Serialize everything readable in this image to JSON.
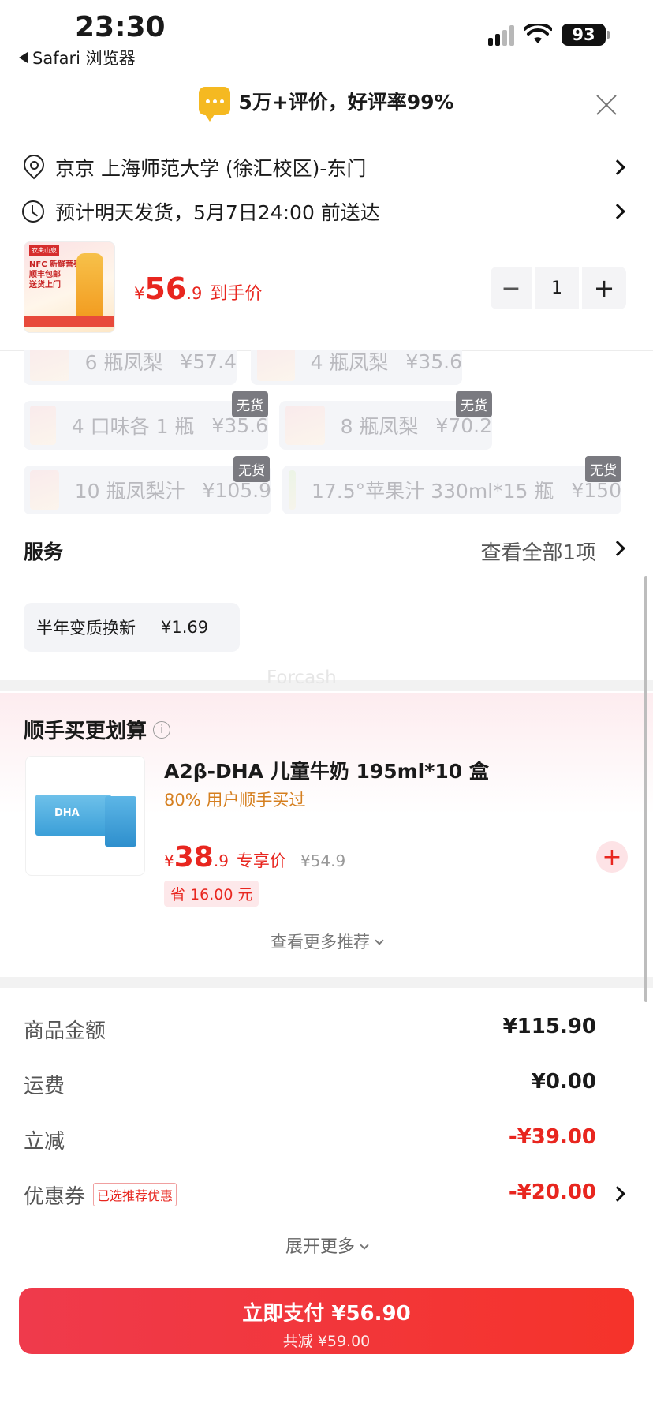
{
  "status_bar": {
    "time": "23:30",
    "back_app": "Safari 浏览器",
    "battery": "93"
  },
  "banner": {
    "text": "5万+评价，好评率99%"
  },
  "address": {
    "text": "京京  上海师范大学 (徐汇校区)-东门"
  },
  "delivery": {
    "text": "预计明天发货，5月7日24:00 前送达"
  },
  "product": {
    "currency": "¥",
    "price_int": "56",
    "price_dec": ".9",
    "price_suffix": "到手价",
    "quantity": "1",
    "minus": "−",
    "plus": "+",
    "thumb_text": "NFC 新鲜营养\n顺丰包邮\n送货上门"
  },
  "variants": [
    {
      "label": "6 瓶凤梨",
      "price": "¥57.4",
      "badge": ""
    },
    {
      "label": "4 瓶凤梨",
      "price": "¥35.6",
      "badge": ""
    },
    {
      "label": "4 口味各 1 瓶",
      "price": "¥35.6",
      "badge": "无货"
    },
    {
      "label": "8 瓶凤梨",
      "price": "¥70.2",
      "badge": "无货"
    },
    {
      "label": "10 瓶凤梨汁",
      "price": "¥105.9",
      "badge": "无货"
    },
    {
      "label": "17.5°苹果汁 330ml*15 瓶",
      "price": "¥150",
      "badge": "无货"
    }
  ],
  "services": {
    "title": "服务",
    "view_all": "查看全部1项",
    "chip_label": "半年变质换新",
    "chip_price": "¥1.69"
  },
  "watermark": "Forcash",
  "recommend": {
    "title": "顺手买更划算",
    "info": "i",
    "name": "A2β-DHA 儿童牛奶 195ml*10 盒",
    "sub": "80% 用户顺手买过",
    "currency": "¥",
    "price_int": "38",
    "price_dec": ".9",
    "price_label": "专享价",
    "orig_price": "¥54.9",
    "save": "省 16.00 元",
    "add": "+",
    "more": "查看更多推荐"
  },
  "summary": {
    "goods_label": "商品金额",
    "goods_value": "¥115.90",
    "shipping_label": "运费",
    "shipping_value": "¥0.00",
    "discount_label": "立减",
    "discount_value": "-¥39.00",
    "coupon_label": "优惠券",
    "coupon_badge": "已选推荐优惠",
    "coupon_value": "-¥20.00",
    "expand": "展开更多"
  },
  "pay": {
    "main": "立即支付 ¥56.90",
    "sub": "共减 ¥59.00"
  },
  "colors": {
    "accent_red": "#e8261f",
    "coupon_orange": "#d57f1f",
    "pay_gradient_start": "#ef3a4c"
  }
}
